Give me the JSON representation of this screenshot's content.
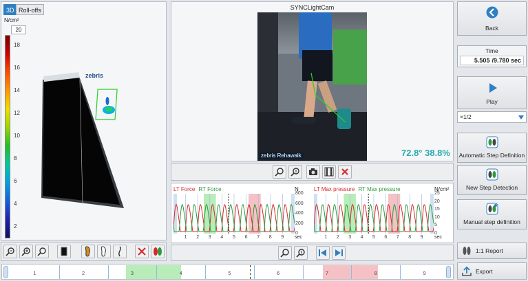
{
  "left_panel": {
    "tab_3d": "3D",
    "tab_rolloffs": "Roll-offs",
    "unit": "N/cm²",
    "scale_max": "20",
    "scale_labels": [
      "18",
      "16",
      "14",
      "12",
      "10",
      "8",
      "6",
      "4",
      "2"
    ],
    "platform_logo": "zebris"
  },
  "video": {
    "title": "SYNCLightCam",
    "overlay_values": "72.8° 38.8%",
    "watermark": "zebris Rehawalk"
  },
  "force_chart": {
    "lt_label": "LT Force",
    "rt_label": "RT Force",
    "unit": "N",
    "y_ticks": [
      "800",
      "600",
      "400",
      "200",
      "0"
    ],
    "x_ticks": [
      "1",
      "2",
      "3",
      "4",
      "5",
      "6",
      "7",
      "8",
      "9"
    ],
    "x_unit": "sec"
  },
  "pressure_chart": {
    "lt_label": "LT Max pressure",
    "rt_label": "RT Max pressure",
    "unit": "N/cm²",
    "y_ticks": [
      "25",
      "20",
      "15",
      "10",
      "5",
      "0"
    ],
    "x_ticks": [
      "1",
      "2",
      "3",
      "4",
      "5",
      "6",
      "7",
      "8",
      "9"
    ],
    "x_unit": "sec"
  },
  "right_panel": {
    "back_label": "Back",
    "time_label": "Time",
    "time_current": "5.505",
    "time_total": "/9.780 sec",
    "play_label": "Play",
    "speed_value": "×1/2",
    "auto_step_label": "Automatic Step Definition",
    "new_step_label": "New Step Detection",
    "manual_step_label": "Manual step definition",
    "report_label": "1:1 Report",
    "export_label": "Export"
  },
  "timeline": {
    "labels": [
      "1",
      "2",
      "3",
      "4",
      "5",
      "6",
      "7",
      "8",
      "9"
    ]
  },
  "colors": {
    "lt": "#d42a2a",
    "rt": "#2e9a3c",
    "accent": "#2f7fc2",
    "overlay": "#2aaab0",
    "green_band": "#b8ecb8",
    "red_band": "#f6c1c5"
  }
}
